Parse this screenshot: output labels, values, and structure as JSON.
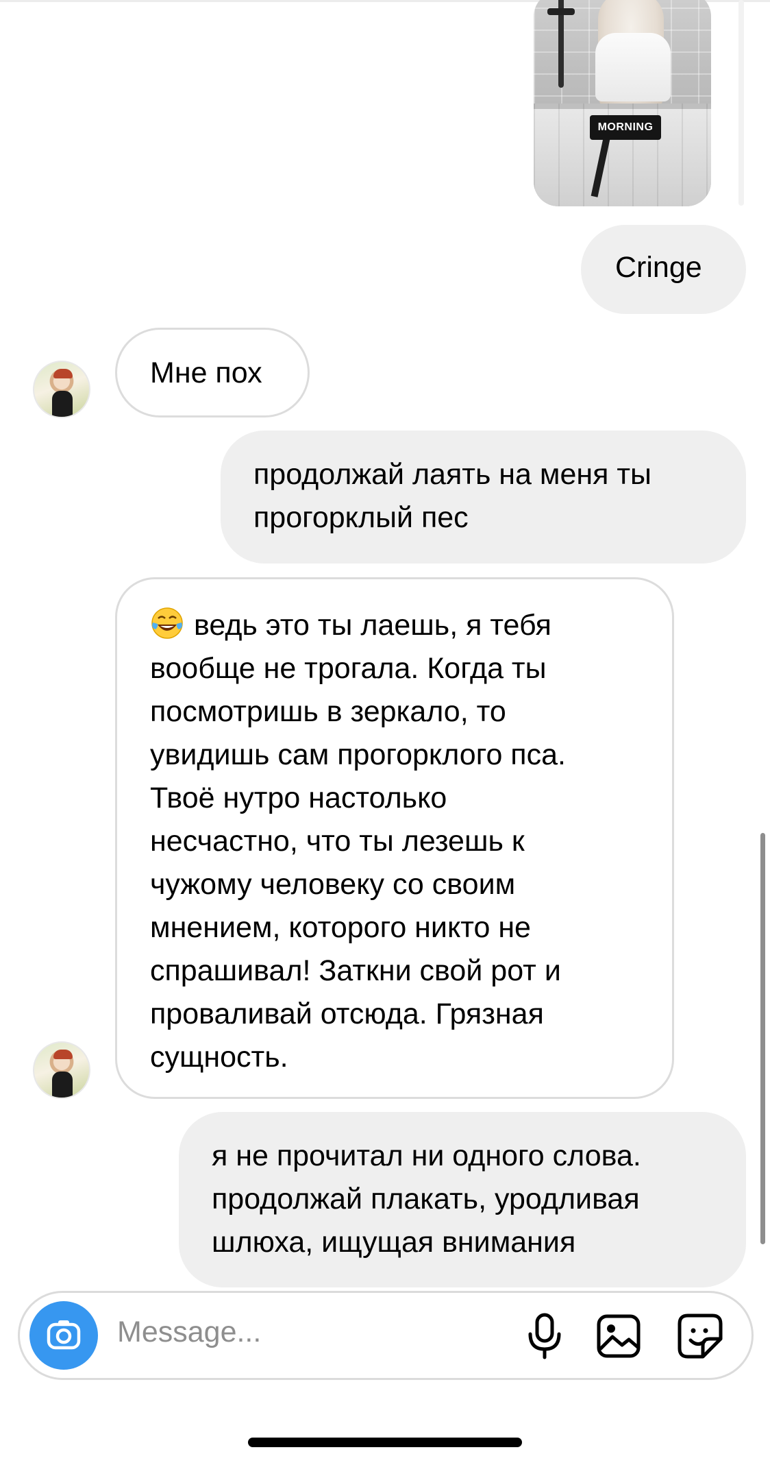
{
  "story": {
    "caption": "MORNING"
  },
  "messages": [
    {
      "direction": "out",
      "text": "Cringe"
    },
    {
      "direction": "in",
      "text": "Мне пох"
    },
    {
      "direction": "out",
      "lines": [
        "продолжай лаять на меня ты",
        "прогорклый пес"
      ]
    },
    {
      "direction": "in",
      "emoji": "face-with-tears-of-joy",
      "lines": [
        "ведь это ты лаешь, я тебя",
        "вообще не трогала. Когда ты",
        "посмотришь в зеркало, то",
        "увидишь сам прогорклого пса.",
        "Твоё нутро настолько",
        "несчастно, что ты лезешь к",
        "чужому человеку со своим",
        "мнением, которого никто не",
        "спрашивал! Заткни свой рот и",
        "проваливай отсюда. Грязная",
        "сущность."
      ]
    },
    {
      "direction": "out",
      "lines": [
        "я не прочитал ни одного слова.",
        "продолжай плакать, уродливая",
        "шлюха, ищущая внимания"
      ]
    }
  ],
  "composer": {
    "placeholder": "Message...",
    "icons": [
      "camera-icon",
      "microphone-icon",
      "gallery-icon",
      "sticker-icon"
    ],
    "accent": "#3797f0"
  }
}
